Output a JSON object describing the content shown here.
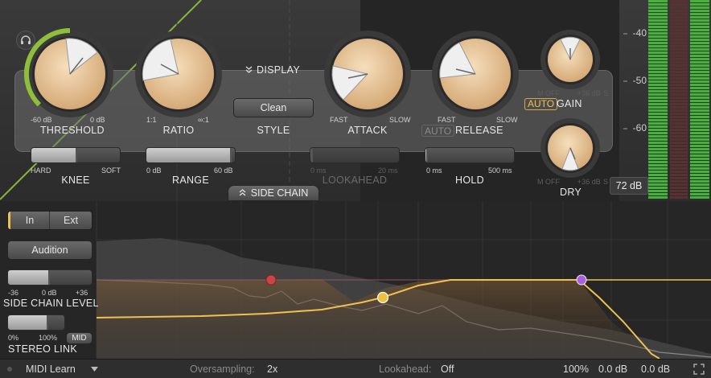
{
  "knobs": {
    "threshold": {
      "label": "THRESHOLD",
      "min": "-60 dB",
      "max": "0 dB"
    },
    "ratio": {
      "label": "RATIO",
      "min": "1:1",
      "max": "∞:1"
    },
    "attack": {
      "label": "ATTACK",
      "min": "FAST",
      "max": "SLOW"
    },
    "release": {
      "label": "RELEASE",
      "min": "FAST",
      "max": "SLOW",
      "auto": "AUTO"
    },
    "gain": {
      "label": "GAIN",
      "auto": "AUTO",
      "min": "M OFF",
      "max": "+36 dB",
      "s": "S"
    },
    "dry": {
      "label": "DRY",
      "min": "M OFF",
      "max": "+36 dB",
      "s": "S"
    }
  },
  "display_label": "DISPLAY",
  "style": {
    "label": "STYLE",
    "value": "Clean"
  },
  "sliders": {
    "knee": {
      "label": "KNEE",
      "min": "HARD",
      "max": "SOFT"
    },
    "range": {
      "label": "RANGE",
      "min": "0 dB",
      "max": "60 dB"
    },
    "lookahead": {
      "label": "LOOKAHEAD",
      "min": "0 ms",
      "max": "20 ms"
    },
    "hold": {
      "label": "HOLD",
      "min": "0 ms",
      "max": "500 ms"
    }
  },
  "side_chain_label": "SIDE CHAIN",
  "meter": {
    "ticks": [
      "-40",
      "-50",
      "-60"
    ],
    "readout": "72 dB"
  },
  "sidechain_panel": {
    "in_label": "In",
    "ext_label": "Ext",
    "audition_label": "Audition",
    "level": {
      "label": "SIDE CHAIN LEVEL",
      "min": "-36",
      "mid": "0 dB",
      "max": "+36"
    },
    "stereo": {
      "label": "STEREO LINK",
      "min": "0%",
      "max": "100%",
      "mid_btn": "MID"
    }
  },
  "status": {
    "midi_learn": "MIDI Learn",
    "oversampling_label": "Oversampling:",
    "oversampling_value": "2x",
    "lookahead_label": "Lookahead:",
    "lookahead_value": "Off",
    "zoom": "100%",
    "value1": "0.0 dB",
    "value2": "0.0 dB"
  },
  "colors": {
    "accent": "#f0c050",
    "knob": "#e9c89c",
    "meter": "#3fa83a",
    "threshold_ring": "#8fbf3a",
    "node_red": "#c84646",
    "node_purple": "#a860e0"
  }
}
